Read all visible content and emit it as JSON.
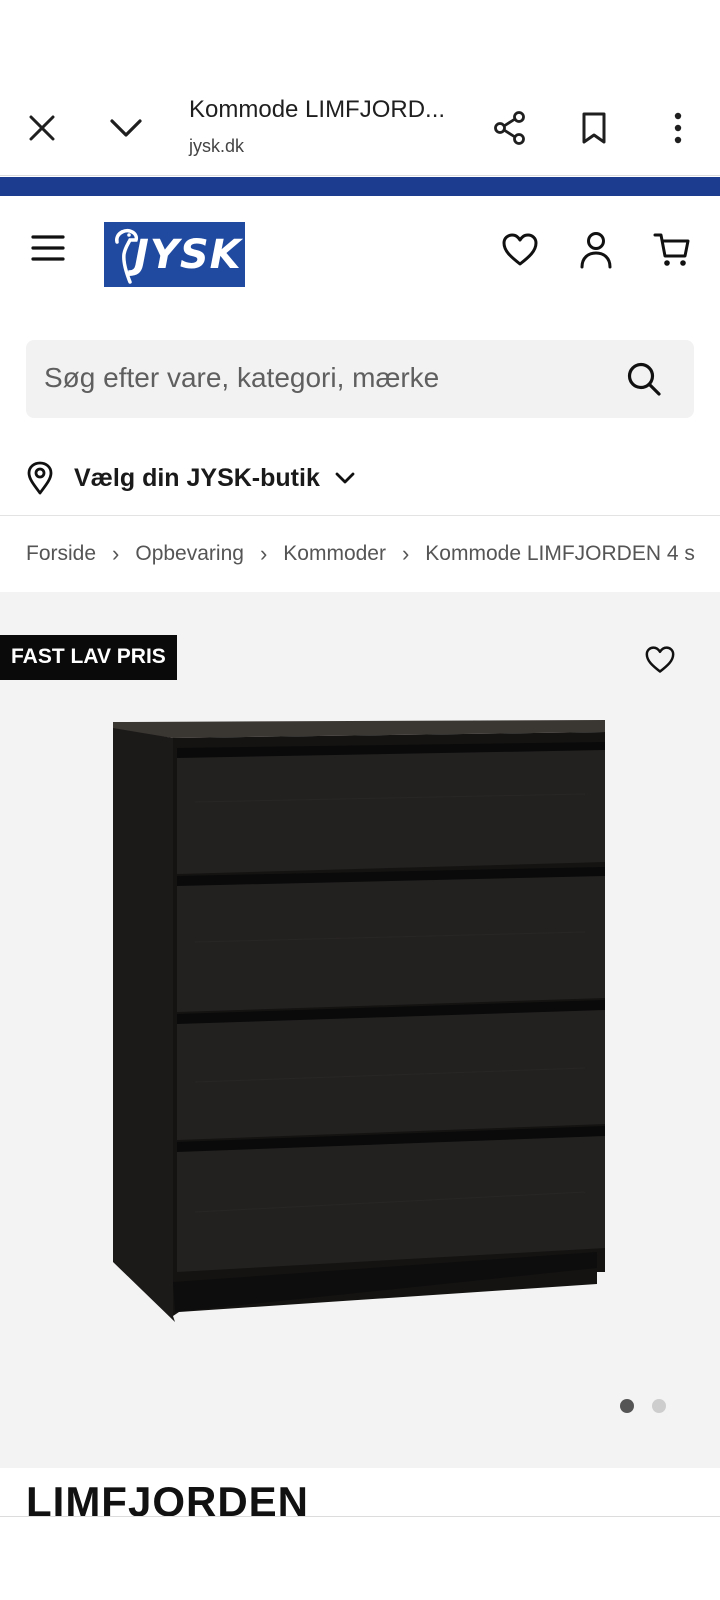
{
  "browser": {
    "page_title": "Kommode LIMFJORD...",
    "url": "jysk.dk"
  },
  "header": {
    "logo_text": "JYSK"
  },
  "search": {
    "placeholder": "Søg efter vare, kategori, mærke"
  },
  "store": {
    "label": "Vælg din JYSK-butik"
  },
  "breadcrumb": [
    "Forside",
    "Opbevaring",
    "Kommoder",
    "Kommode LIMFJORDEN 4 s"
  ],
  "product": {
    "badge": "FAST LAV PRIS",
    "title": "LIMFJORDEN",
    "image_count": 2,
    "active_image": 1
  },
  "colors": {
    "brand_blue": "#1f4aa0",
    "stripe_blue": "#1b3c8f",
    "badge_bg": "#0a0a0a",
    "gallery_bg": "#f3f3f3"
  }
}
